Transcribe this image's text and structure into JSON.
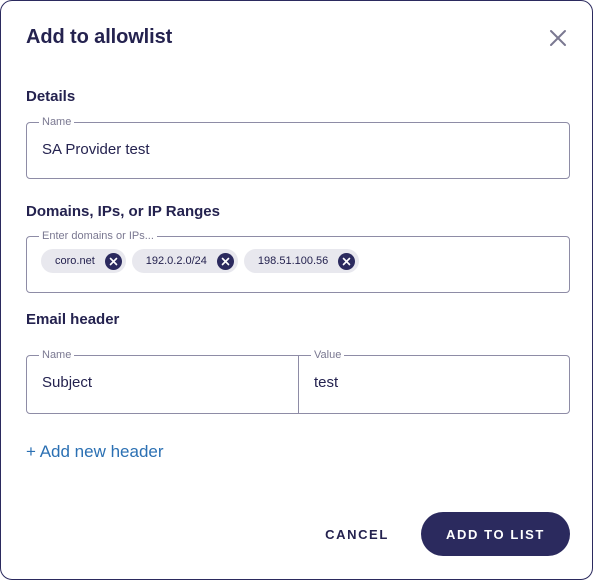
{
  "dialog": {
    "title": "Add to allowlist",
    "close_icon": "close-icon"
  },
  "details": {
    "section_label": "Details",
    "name_field": {
      "label": "Name",
      "value": "SA Provider test"
    }
  },
  "domains": {
    "section_label": "Domains, IPs, or IP Ranges",
    "field_label": "Enter domains or IPs...",
    "chips": [
      {
        "label": "coro.net",
        "remove_icon": "remove-chip-icon"
      },
      {
        "label": "192.0.2.0/24",
        "remove_icon": "remove-chip-icon"
      },
      {
        "label": "198.51.100.56",
        "remove_icon": "remove-chip-icon"
      }
    ]
  },
  "email_header": {
    "section_label": "Email header",
    "name_field": {
      "label": "Name",
      "value": "Subject"
    },
    "value_field": {
      "label": "Value",
      "value": "test"
    },
    "add_link": "+ Add new header"
  },
  "actions": {
    "cancel_label": "CANCEL",
    "submit_label": "ADD TO LIST"
  },
  "colors": {
    "primary": "#2b2a5e",
    "link": "#2b70b3",
    "chip_bg": "#e8e8ee",
    "text": "#24224f"
  }
}
